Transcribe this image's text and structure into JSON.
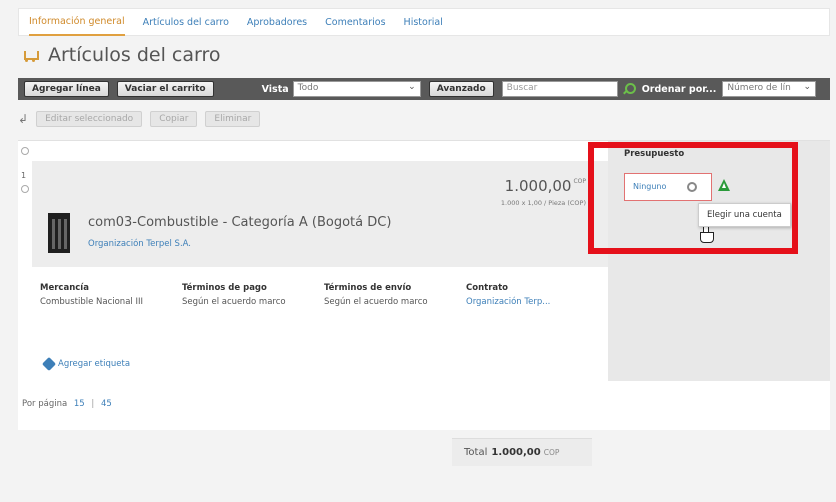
{
  "tabs": [
    {
      "label": "Información general",
      "active": true
    },
    {
      "label": "Artículos del carro",
      "active": false
    },
    {
      "label": "Aprobadores",
      "active": false
    },
    {
      "label": "Comentarios",
      "active": false
    },
    {
      "label": "Historial",
      "active": false
    }
  ],
  "page_title": "Artículos del carro",
  "toolbar": {
    "add_line": "Agregar línea",
    "empty_cart": "Vaciar el carrito",
    "view_label": "Vista",
    "view_value": "Todo",
    "advanced": "Avanzado",
    "search_placeholder": "Buscar",
    "order_label": "Ordenar por...",
    "order_value": "Número de lín"
  },
  "actions": {
    "edit_selected": "Editar seleccionado",
    "copy": "Copiar",
    "delete": "Eliminar"
  },
  "item": {
    "row_number": "1",
    "price": "1.000,00",
    "currency": "COP",
    "price_detail": "1.000 x 1,00 / Pieza (COP)",
    "name": "com03-Combustible - Categoría A (Bogotá DC)",
    "organization": "Organización Terpel S.A.",
    "details": [
      {
        "header": "Mercancía",
        "value": "Combustible Nacional III",
        "link": false
      },
      {
        "header": "Términos de pago",
        "value": "Según el acuerdo marco",
        "link": false
      },
      {
        "header": "Términos de envío",
        "value": "Según el acuerdo marco",
        "link": false
      },
      {
        "header": "Contrato",
        "value": "Organización Terp...",
        "link": true
      }
    ],
    "add_tag": "Agregar etiqueta"
  },
  "budget": {
    "header": "Presupuesto",
    "value": "Ninguno",
    "tooltip": "Elegir una cuenta"
  },
  "pagination": {
    "label": "Por página",
    "option_1": "15",
    "separator": "|",
    "option_2": "45"
  },
  "total": {
    "label": "Total",
    "value": "1.000,00",
    "currency": "COP"
  },
  "colors": {
    "accent": "#3d7fb8",
    "highlight": "#e5101a",
    "active_tab": "#d08a2a"
  }
}
